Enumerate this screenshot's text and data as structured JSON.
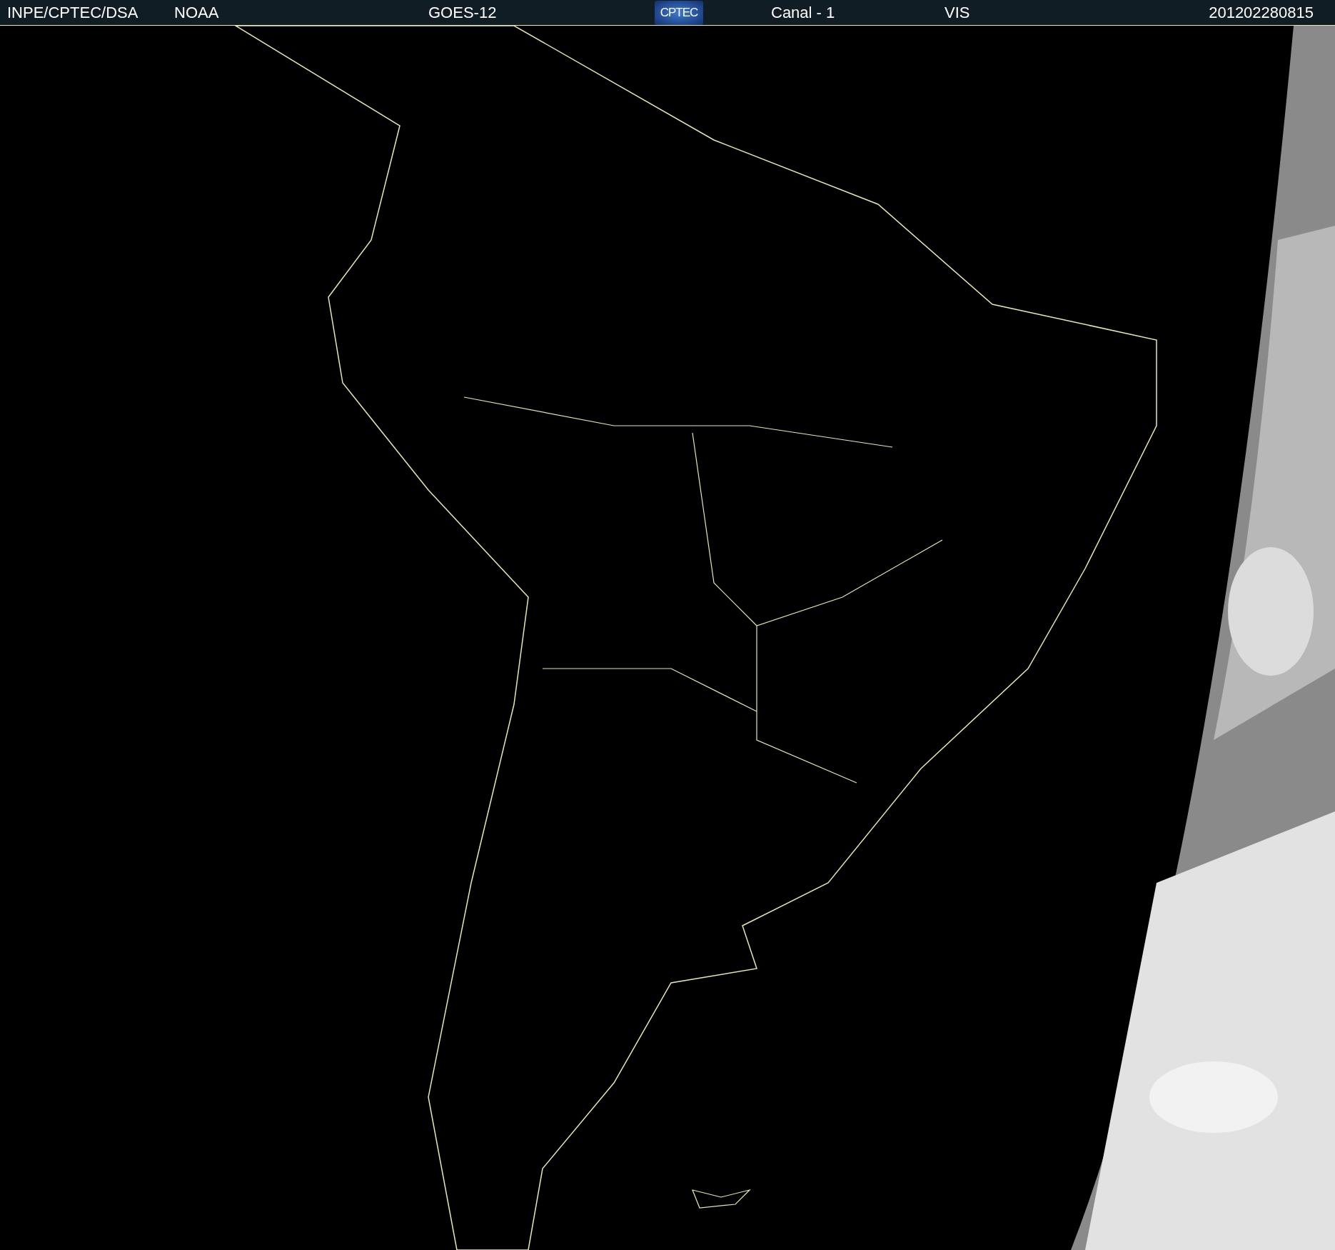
{
  "header": {
    "labels": [
      "INPE/CPTEC/DSA",
      "NOAA",
      "GOES-12"
    ],
    "logo": "CPTEC",
    "channel": "Canal - 1",
    "band": "VIS",
    "timestamp": "201202280815"
  }
}
